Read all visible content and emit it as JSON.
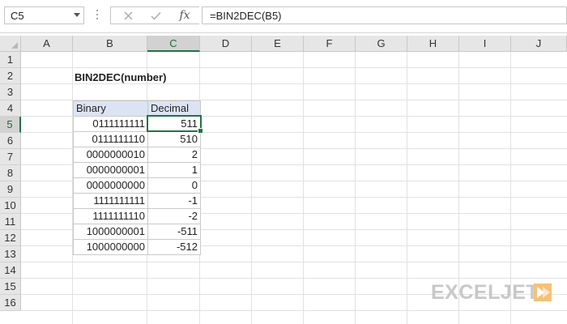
{
  "formula_bar": {
    "name_box": "C5",
    "cancel_icon": "close-icon",
    "enter_icon": "check-icon",
    "fx_label": "fx",
    "formula": "=BIN2DEC(B5)"
  },
  "columns": [
    "A",
    "B",
    "C",
    "D",
    "E",
    "F",
    "G",
    "H",
    "I",
    "J"
  ],
  "rows": [
    "1",
    "2",
    "3",
    "4",
    "5",
    "6",
    "7",
    "8",
    "9",
    "10",
    "11",
    "12",
    "13",
    "14",
    "15",
    "16"
  ],
  "selected": {
    "column": "C",
    "row": "5"
  },
  "title": "BIN2DEC(number)",
  "table": {
    "headers": [
      "Binary",
      "Decimal"
    ],
    "rows": [
      {
        "binary": "0111111111",
        "decimal": "511"
      },
      {
        "binary": "0111111110",
        "decimal": "510"
      },
      {
        "binary": "0000000010",
        "decimal": "2"
      },
      {
        "binary": "0000000001",
        "decimal": "1"
      },
      {
        "binary": "0000000000",
        "decimal": "0"
      },
      {
        "binary": "1111111111",
        "decimal": "-1"
      },
      {
        "binary": "1111111110",
        "decimal": "-2"
      },
      {
        "binary": "1000000001",
        "decimal": "-511"
      },
      {
        "binary": "1000000000",
        "decimal": "-512"
      }
    ]
  },
  "watermark": "EXCELJET",
  "colors": {
    "selection": "#217346",
    "header_fill": "#dce4f3",
    "logo": "#c8c8c8",
    "logo_accent": "#f5a623"
  }
}
